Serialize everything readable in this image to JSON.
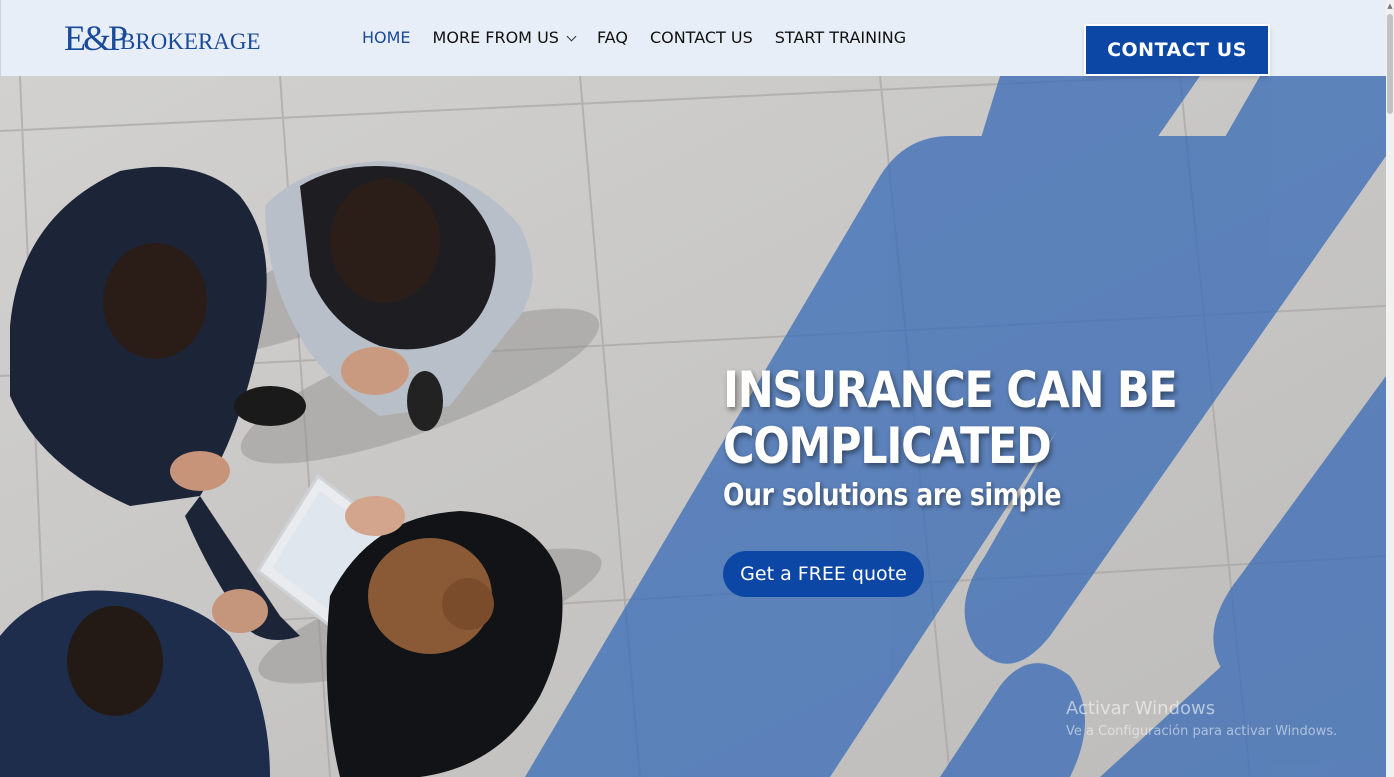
{
  "header": {
    "logo_mark": "E&P",
    "logo_text": "BROKERAGE",
    "nav": [
      {
        "label": "HOME"
      },
      {
        "label": "MORE FROM US"
      },
      {
        "label": "FAQ"
      },
      {
        "label": "CONTACT US"
      },
      {
        "label": "START TRAINING"
      }
    ],
    "cta_label": "CONTACT US"
  },
  "hero": {
    "headline_line1": "INSURANCE CAN BE",
    "headline_line2": "COMPLICATED",
    "subheadline": "Our solutions are simple",
    "button_label": "Get a FREE quote",
    "image_alt": "Business people meeting, top view"
  },
  "watermark": {
    "title": "Activar Windows",
    "subtitle": "Ve a Configuración para activar Windows."
  },
  "colors": {
    "brand_blue": "#0d47a6",
    "header_bg": "#e8eef7",
    "stripe_blue": "#3f6fb8"
  },
  "icons": {
    "dropdown": "chevron-down-icon",
    "scroll_up": "arrow-up-icon"
  }
}
